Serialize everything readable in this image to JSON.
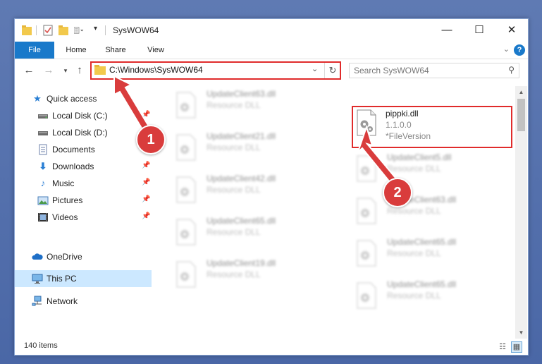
{
  "window": {
    "title": "SysWOW64",
    "controls": {
      "minimize": "—",
      "maximize": "☐",
      "close": "✕"
    }
  },
  "ribbon": {
    "tabs": [
      "File",
      "Home",
      "Share",
      "View"
    ],
    "help": "?"
  },
  "nav": {
    "address": "C:\\Windows\\SysWOW64",
    "search_placeholder": "Search SysWOW64"
  },
  "sidebar": {
    "items": [
      {
        "label": "Quick access",
        "icon": "star-icon",
        "pinned": false
      },
      {
        "label": "Local Disk (C:)",
        "icon": "drive-icon",
        "pinned": true
      },
      {
        "label": "Local Disk (D:)",
        "icon": "drive-icon",
        "pinned": false
      },
      {
        "label": "Documents",
        "icon": "document-icon",
        "pinned": true
      },
      {
        "label": "Downloads",
        "icon": "download-icon",
        "pinned": true
      },
      {
        "label": "Music",
        "icon": "music-icon",
        "pinned": true
      },
      {
        "label": "Pictures",
        "icon": "pictures-icon",
        "pinned": true
      },
      {
        "label": "Videos",
        "icon": "video-icon",
        "pinned": true
      },
      {
        "label": "OneDrive",
        "icon": "cloud-icon",
        "pinned": false
      },
      {
        "label": "This PC",
        "icon": "computer-icon",
        "pinned": false,
        "selected": true
      },
      {
        "label": "Network",
        "icon": "network-icon",
        "pinned": false
      }
    ]
  },
  "files": {
    "left": [
      {
        "name": "UpdateClient63.dll",
        "desc": "Resource DLL"
      },
      {
        "name": "UpdateClient21.dll",
        "desc": "Resource DLL"
      },
      {
        "name": "UpdateClient42.dll",
        "desc": "Resource DLL"
      },
      {
        "name": "UpdateClient65.dll",
        "desc": "Resource DLL"
      },
      {
        "name": "UpdateClient19.dll",
        "desc": "Resource DLL"
      }
    ],
    "highlighted": {
      "name": "pippki.dll",
      "version": "1.1.0.0",
      "desc": "*FileVersion"
    },
    "right": [
      {
        "name": "UpdateClient5.dll",
        "desc": "Resource DLL"
      },
      {
        "name": "UpdateClient63.dll",
        "desc": "Resource DLL"
      },
      {
        "name": "UpdateClient65.dll",
        "desc": "Resource DLL"
      },
      {
        "name": "UpdateClient65.dll",
        "desc": "Resource DLL"
      }
    ]
  },
  "status": {
    "item_count": "140 items"
  },
  "annotations": {
    "step1": "1",
    "step2": "2"
  },
  "colors": {
    "accent": "#1979ca",
    "highlight": "#e02b2b",
    "badge": "#d93c3c",
    "selection": "#cce8ff"
  }
}
